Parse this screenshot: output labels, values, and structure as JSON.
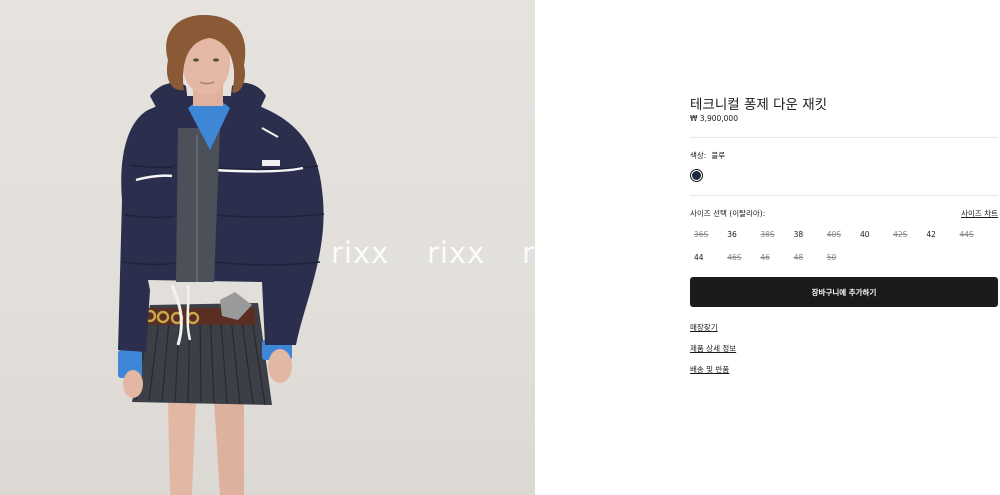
{
  "product": {
    "title": "테크니컬 퐁제 다운 재킷",
    "price": "₩ 3,900,000",
    "image_alt": "product-photo"
  },
  "watermark": [
    "rixx",
    "rixx",
    "r"
  ],
  "color": {
    "label": "색상:",
    "value": "블루",
    "swatch_hex": "#1f2a40"
  },
  "size": {
    "label": "사이즈 선택 (이탈리아):",
    "chart_link": "사이즈 차트",
    "options": [
      {
        "label": "36S",
        "available": false
      },
      {
        "label": "36",
        "available": true
      },
      {
        "label": "38S",
        "available": false
      },
      {
        "label": "38",
        "available": true
      },
      {
        "label": "40S",
        "available": false
      },
      {
        "label": "40",
        "available": true
      },
      {
        "label": "42S",
        "available": false
      },
      {
        "label": "42",
        "available": true
      },
      {
        "label": "44S",
        "available": false
      },
      {
        "label": "44",
        "available": true
      },
      {
        "label": "46S",
        "available": false
      },
      {
        "label": "46",
        "available": false
      },
      {
        "label": "48",
        "available": false
      },
      {
        "label": "50",
        "available": false
      }
    ]
  },
  "cart_button": "장바구니에 추가하기",
  "links": {
    "store_finder": "매장찾기",
    "product_details": "제품 상세 정보",
    "shipping_returns": "배송 및 반품"
  }
}
